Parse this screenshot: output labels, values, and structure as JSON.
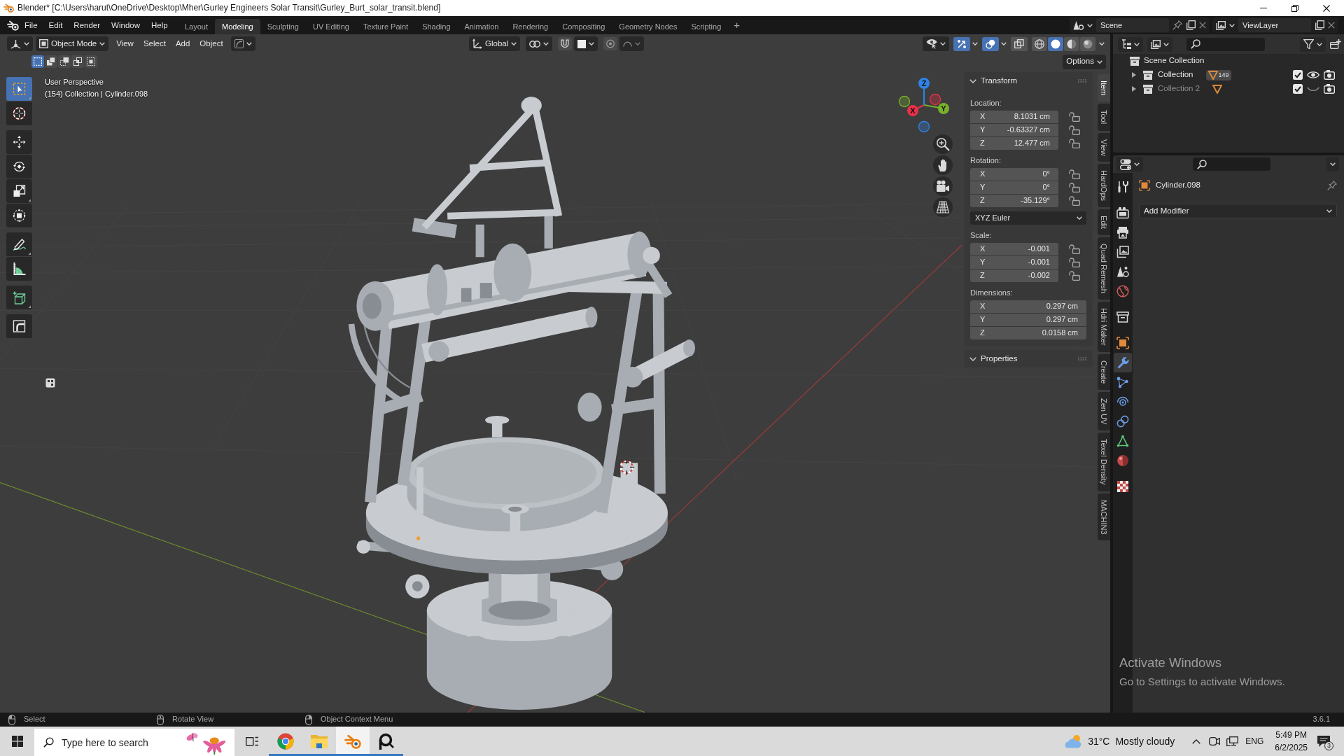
{
  "title_bar": {
    "title": "Blender* [C:\\Users\\harut\\OneDrive\\Desktop\\Mher\\Gurley Engineers Solar Transit\\Gurley_Burt_solar_transit.blend]"
  },
  "top_bar": {
    "menus": [
      "File",
      "Edit",
      "Render",
      "Window",
      "Help"
    ],
    "workspaces": [
      {
        "label": "Layout",
        "selected": false
      },
      {
        "label": "Modeling",
        "selected": true
      },
      {
        "label": "Sculpting",
        "selected": false
      },
      {
        "label": "UV Editing",
        "selected": false
      },
      {
        "label": "Texture Paint",
        "selected": false
      },
      {
        "label": "Shading",
        "selected": false
      },
      {
        "label": "Animation",
        "selected": false
      },
      {
        "label": "Rendering",
        "selected": false
      },
      {
        "label": "Compositing",
        "selected": false
      },
      {
        "label": "Geometry Nodes",
        "selected": false
      },
      {
        "label": "Scripting",
        "selected": false
      }
    ],
    "add_workspace": "+",
    "scene": "Scene",
    "view_layer": "ViewLayer"
  },
  "viewport": {
    "header": {
      "mode": "Object Mode",
      "menus": [
        "View",
        "Select",
        "Add",
        "Object"
      ],
      "orientation": "Global",
      "toggles": [
        {
          "kind": "gizmos",
          "on": true
        },
        {
          "kind": "overlays",
          "on": true
        },
        {
          "kind": "xray",
          "on": false
        }
      ],
      "shading": [
        {
          "kind": "wireframe",
          "selected": false
        },
        {
          "kind": "solid",
          "selected": true
        },
        {
          "kind": "material",
          "selected": false
        },
        {
          "kind": "rendered",
          "selected": false
        }
      ]
    },
    "select_modes": [
      {
        "kind": "set",
        "selected": true
      },
      {
        "kind": "extend",
        "selected": false
      },
      {
        "kind": "subtract",
        "selected": false
      },
      {
        "kind": "invert",
        "selected": false
      },
      {
        "kind": "intersect",
        "selected": false
      }
    ],
    "options": "Options",
    "info": [
      "User Perspective",
      "(154) Collection | Cylinder.098"
    ],
    "tool_groups": [
      [
        {
          "kind": "select",
          "selected": true
        },
        {
          "kind": "cursor",
          "selected": false
        }
      ],
      [
        {
          "kind": "move",
          "selected": false
        },
        {
          "kind": "rotate",
          "selected": false
        },
        {
          "kind": "scale",
          "selected": false
        },
        {
          "kind": "transform",
          "selected": false
        }
      ],
      [
        {
          "kind": "annotate",
          "selected": false
        },
        {
          "kind": "measure",
          "selected": false
        }
      ],
      [
        {
          "kind": "add_cube",
          "selected": false
        }
      ],
      [
        {
          "kind": "corner",
          "selected": false
        }
      ]
    ],
    "gizmo_axes": [
      {
        "label": "X",
        "color": "#e8314a"
      },
      {
        "label": "Y",
        "color": "#7ab02c"
      },
      {
        "label": "Z",
        "color": "#2f83e6"
      }
    ],
    "sidebar": {
      "tabs": [
        {
          "label": "Item",
          "selected": true
        },
        {
          "label": "Tool",
          "selected": false
        },
        {
          "label": "View",
          "selected": false
        },
        {
          "label": "HardOps",
          "selected": false
        },
        {
          "label": "Edit",
          "selected": false
        },
        {
          "label": "Quad Remesh",
          "selected": false
        },
        {
          "label": "Hdri Maker",
          "selected": false
        },
        {
          "label": "Create",
          "selected": false
        },
        {
          "label": "Zen UV",
          "selected": false
        },
        {
          "label": "Texel Density",
          "selected": false
        },
        {
          "label": "MACHIN3",
          "selected": false
        }
      ],
      "transform": {
        "title": "Transform",
        "expanded": true,
        "groups": [
          {
            "label": "Location:",
            "fields": [
              {
                "axis": "X",
                "value": "8.1031 cm",
                "locked": false
              },
              {
                "axis": "Y",
                "value": "-0.63327 cm",
                "locked": false
              },
              {
                "axis": "Z",
                "value": "12.477 cm",
                "locked": false
              }
            ]
          },
          {
            "label": "Rotation:",
            "fields": [
              {
                "axis": "X",
                "value": "0°",
                "locked": false
              },
              {
                "axis": "Y",
                "value": "0°",
                "locked": false
              },
              {
                "axis": "Z",
                "value": "-35.129°",
                "locked": false
              }
            ],
            "mode": "XYZ Euler"
          },
          {
            "label": "Scale:",
            "fields": [
              {
                "axis": "X",
                "value": "-0.001",
                "locked": false
              },
              {
                "axis": "Y",
                "value": "-0.001",
                "locked": false
              },
              {
                "axis": "Z",
                "value": "-0.002",
                "locked": false
              }
            ]
          },
          {
            "label": "Dimensions:",
            "fields": [
              {
                "axis": "X",
                "value": "0.297 cm"
              },
              {
                "axis": "Y",
                "value": "0.297 cm"
              },
              {
                "axis": "Z",
                "value": "0.0158 cm"
              }
            ]
          }
        ]
      },
      "properties": {
        "title": "Properties",
        "expanded": true
      }
    }
  },
  "outliner": {
    "root": "Scene Collection",
    "collections": [
      {
        "label": "Collection",
        "expanded": false,
        "checked": true,
        "visible": true,
        "count": "149"
      },
      {
        "label": "Collection 2",
        "expanded": false,
        "checked": true,
        "visible": false
      }
    ]
  },
  "properties": {
    "tab_groups": [
      [
        {
          "kind": "tool",
          "selected": false
        }
      ],
      [
        {
          "kind": "render",
          "selected": false
        },
        {
          "kind": "output",
          "selected": false
        },
        {
          "kind": "view_layer",
          "selected": false
        },
        {
          "kind": "scene",
          "selected": false
        },
        {
          "kind": "world",
          "selected": false
        }
      ],
      [
        {
          "kind": "collection",
          "selected": false
        }
      ],
      [
        {
          "kind": "object",
          "selected": false
        },
        {
          "kind": "modifiers",
          "selected": true
        },
        {
          "kind": "particles",
          "selected": false
        },
        {
          "kind": "physics",
          "selected": false
        },
        {
          "kind": "constraints",
          "selected": false
        },
        {
          "kind": "data",
          "selected": false
        },
        {
          "kind": "material",
          "selected": false
        }
      ],
      [
        {
          "kind": "texture",
          "selected": false
        }
      ]
    ],
    "object_name": "Cylinder.098",
    "add_modifier": "Add Modifier"
  },
  "status_bar": {
    "hints": [
      {
        "kind": "left",
        "label": "Select"
      },
      {
        "kind": "middle",
        "label": "Rotate View"
      },
      {
        "kind": "right",
        "label": "Object Context Menu"
      }
    ],
    "version": "3.6.1"
  },
  "taskbar": {
    "search": {
      "placeholder": "Type here to search"
    },
    "apps": [
      {
        "kind": "task_view",
        "running": false,
        "selected": false
      },
      {
        "kind": "browser",
        "running": true,
        "selected": false
      },
      {
        "kind": "files",
        "running": true,
        "selected": false
      },
      {
        "kind": "blender",
        "running": true,
        "selected": true
      },
      {
        "kind": "magnifier",
        "running": true,
        "selected": false
      }
    ],
    "weather": {
      "temperature": "31°C",
      "condition": "Mostly cloudy"
    },
    "language": "ENG",
    "time": "5:49 PM",
    "date": "6/2/2025",
    "notifications": "3"
  },
  "system_notice": {
    "title": "Activate Windows",
    "text": "Go to Settings to activate Windows."
  }
}
